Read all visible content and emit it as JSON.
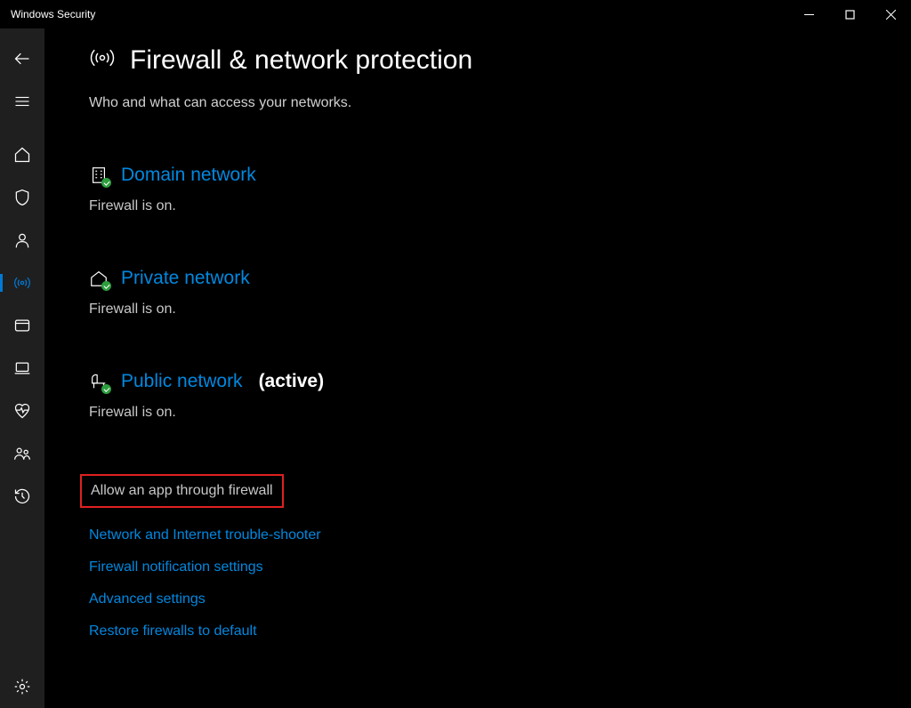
{
  "window": {
    "title": "Windows Security"
  },
  "page": {
    "title": "Firewall & network protection",
    "subtitle": "Who and what can access your networks."
  },
  "networks": {
    "domain": {
      "label": "Domain network",
      "status": "Firewall is on."
    },
    "private": {
      "label": "Private network",
      "status": "Firewall is on."
    },
    "public": {
      "label": "Public network",
      "active_label": "(active)",
      "status": "Firewall is on."
    }
  },
  "links": {
    "allow_app": "Allow an app through firewall",
    "troubleshooter": "Network and Internet trouble-shooter",
    "notifications": "Firewall notification settings",
    "advanced": "Advanced settings",
    "restore": "Restore firewalls to default"
  }
}
